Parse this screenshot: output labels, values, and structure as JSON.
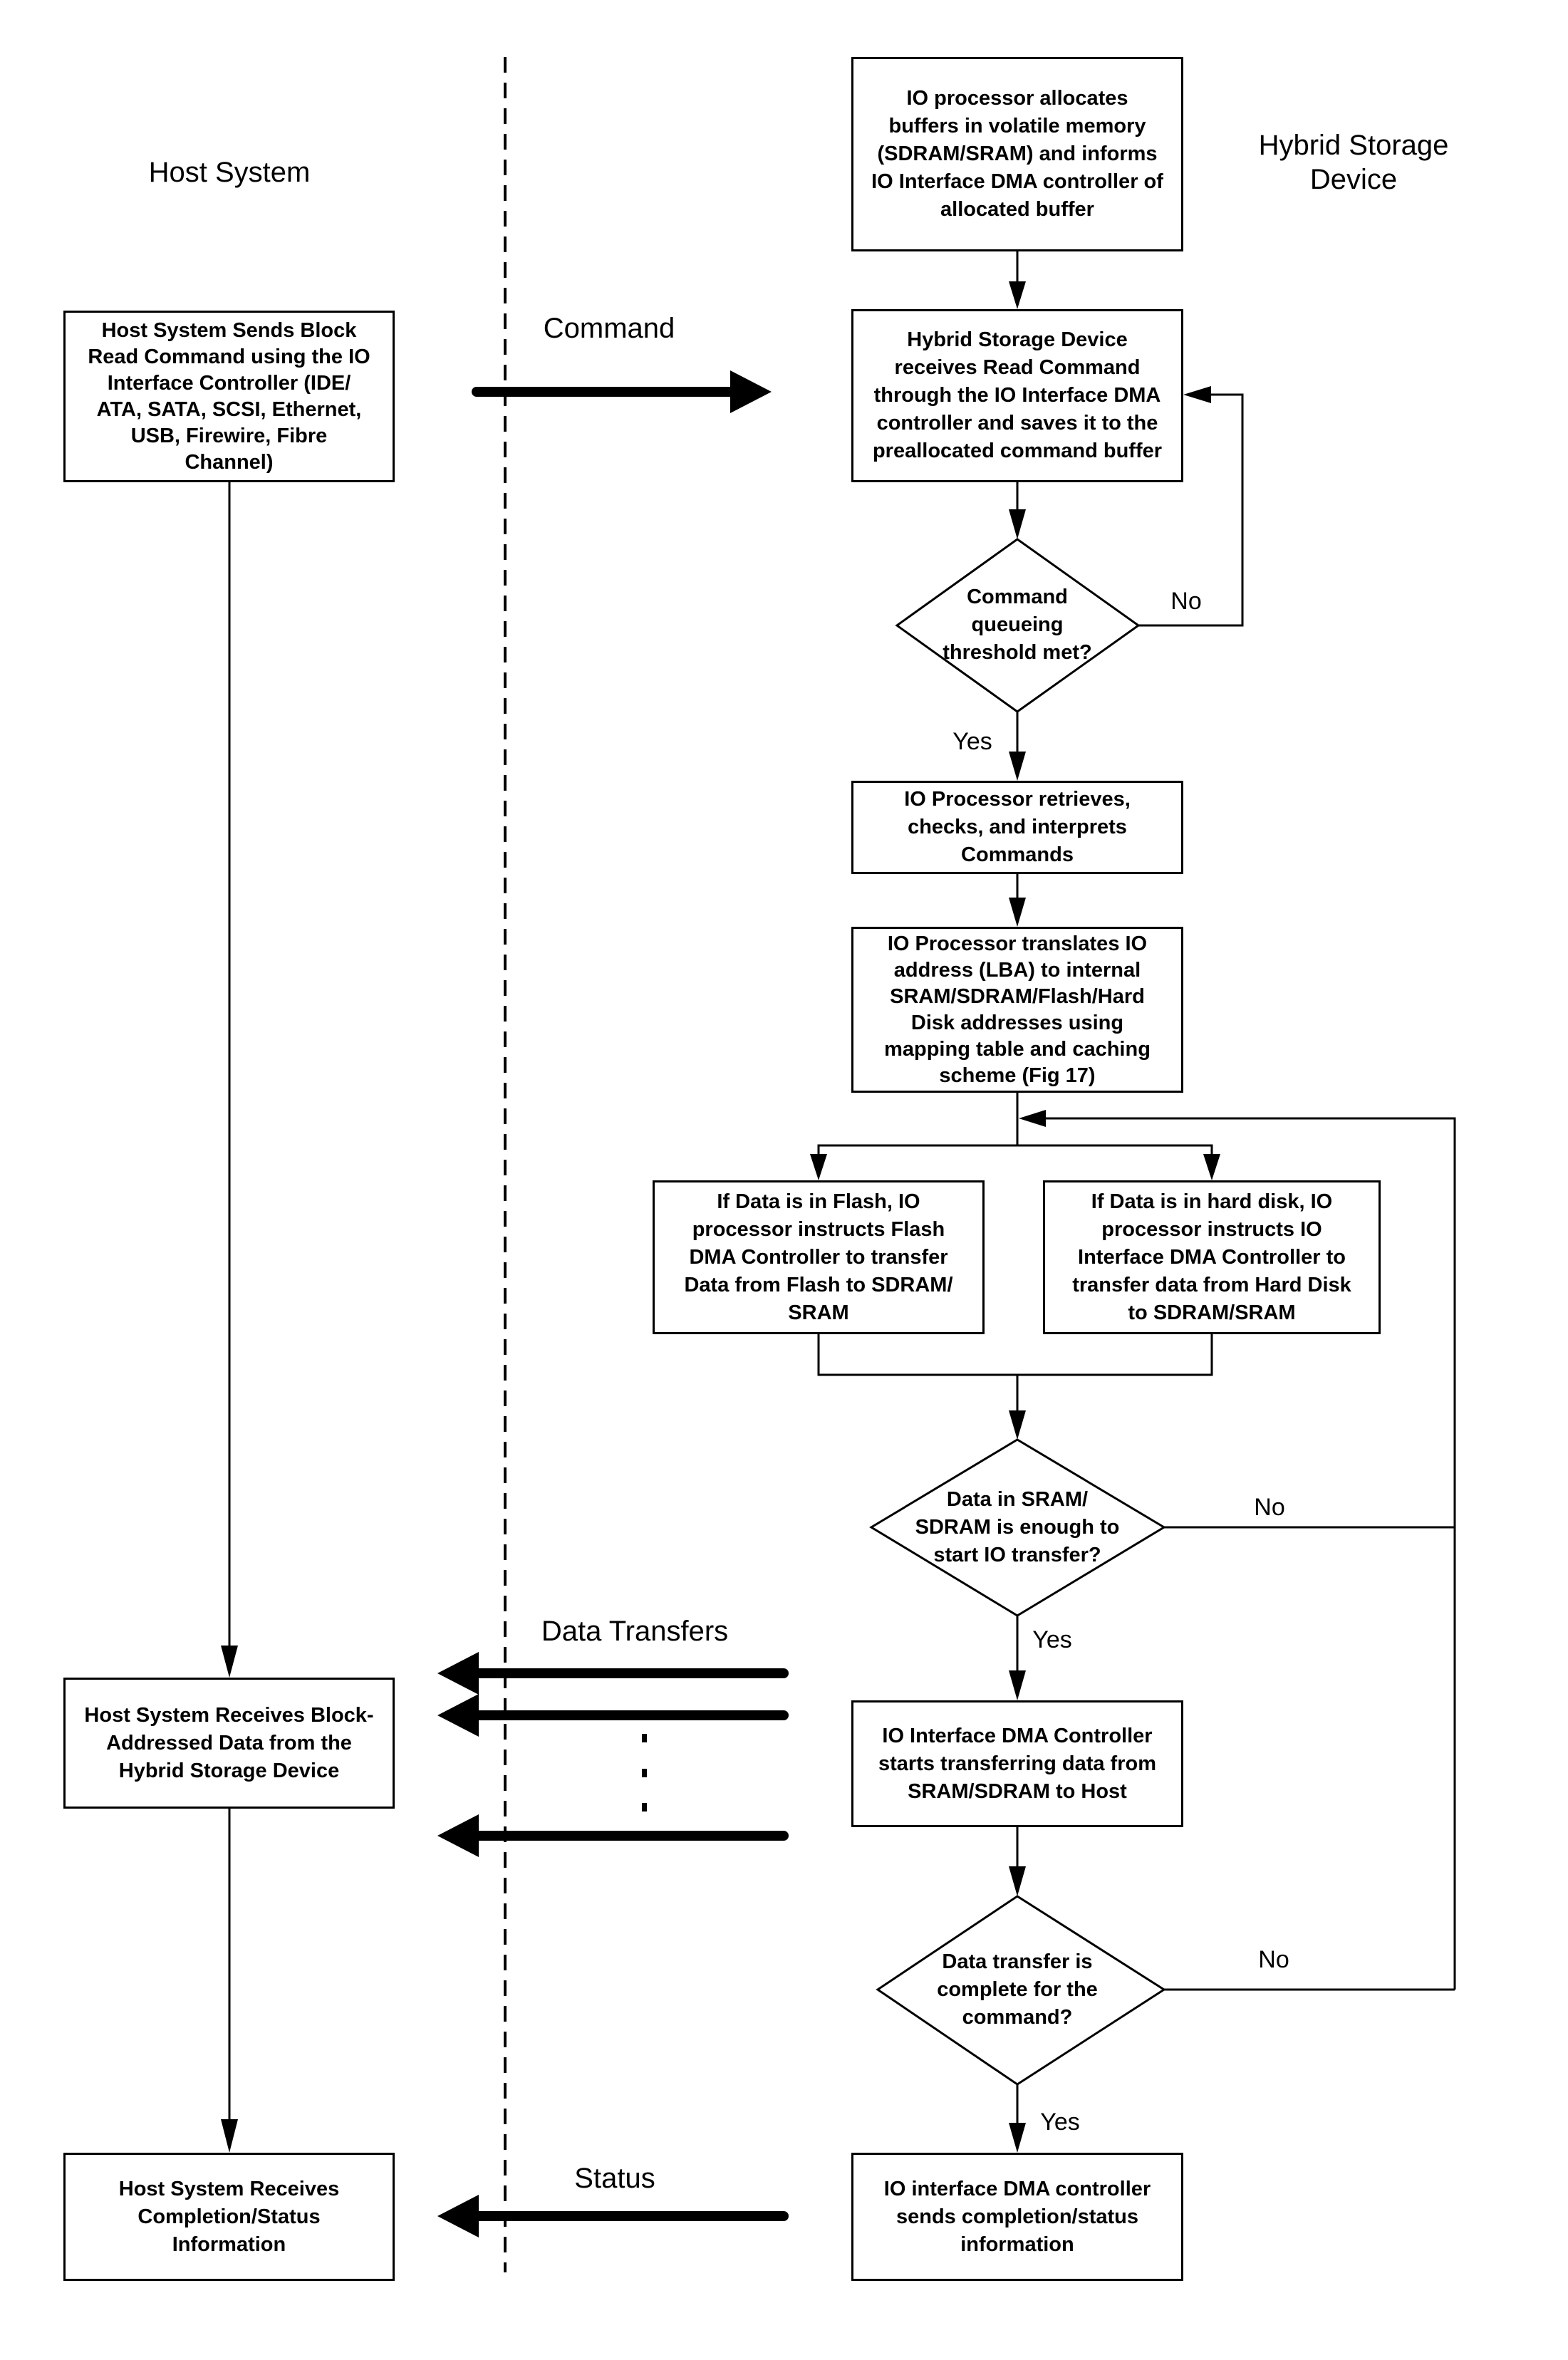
{
  "lanes": {
    "host_title": "Host System",
    "device_title_line1": "Hybrid Storage",
    "device_title_line2": "Device"
  },
  "messages": {
    "command": "Command",
    "data_transfers": "Data Transfers",
    "status": "Status"
  },
  "host_steps": [
    {
      "lines": [
        "Host System Sends Block",
        "Read Command using the  IO",
        "Interface Controller (IDE/",
        "ATA, SATA, SCSI, Ethernet,",
        "USB, Firewire, Fibre",
        "Channel)"
      ]
    },
    {
      "lines": [
        "Host System Receives Block-",
        "Addressed Data from the",
        "Hybrid Storage Device"
      ]
    },
    {
      "lines": [
        "Host System Receives",
        "Completion/Status",
        "Information"
      ]
    }
  ],
  "device_steps": [
    {
      "lines": [
        "IO processor allocates",
        "buffers  in volatile memory",
        "(SDRAM/SRAM) and informs",
        "IO Interface DMA controller of",
        "allocated buffer"
      ]
    },
    {
      "lines": [
        "Hybrid Storage Device",
        "receives Read Command",
        "through the IO Interface DMA",
        "controller and saves it to the",
        "preallocated command buffer"
      ]
    },
    {
      "lines": [
        "IO Processor retrieves,",
        "checks, and  interprets",
        "Commands"
      ]
    },
    {
      "lines": [
        "IO Processor translates IO",
        "address (LBA) to internal",
        "SRAM/SDRAM/Flash/Hard",
        "Disk addresses using",
        "mapping table and caching",
        "scheme (Fig 17)"
      ]
    },
    {
      "lines": [
        "If  Data is in Flash, IO",
        "processor instructs Flash",
        "DMA Controller to transfer",
        "Data from Flash to SDRAM/",
        "SRAM"
      ]
    },
    {
      "lines": [
        "If Data is in hard disk, IO",
        "processor instructs IO",
        "Interface DMA Controller to",
        "transfer data from Hard Disk",
        "to SDRAM/SRAM"
      ]
    },
    {
      "lines": [
        "IO Interface DMA Controller",
        "starts transferring data from",
        "SRAM/SDRAM to Host"
      ]
    },
    {
      "lines": [
        "IO interface DMA controller",
        "sends completion/status",
        "information"
      ]
    }
  ],
  "decisions": [
    {
      "lines": [
        "Command",
        "queueing",
        "threshold met?"
      ],
      "yes": "Yes",
      "no": "No"
    },
    {
      "lines": [
        "Data in SRAM/",
        "SDRAM is enough to",
        "start IO transfer?"
      ],
      "yes": "Yes",
      "no": "No"
    },
    {
      "lines": [
        "Data transfer is",
        "complete for the",
        "command?"
      ],
      "yes": "Yes",
      "no": "No"
    }
  ]
}
